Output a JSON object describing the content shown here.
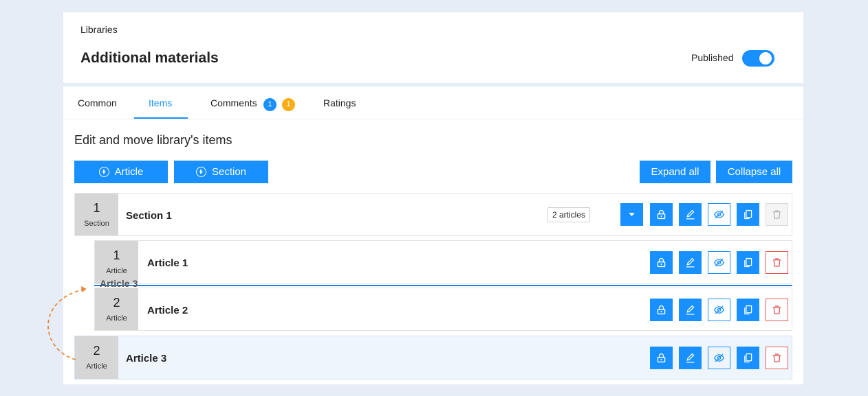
{
  "header": {
    "breadcrumb": "Libraries",
    "title": "Additional materials",
    "published_label": "Published",
    "published": true
  },
  "tabs": [
    {
      "label": "Common",
      "active": false
    },
    {
      "label": "Items",
      "active": true
    },
    {
      "label": "Comments",
      "active": false,
      "badges": [
        "1",
        "1"
      ]
    },
    {
      "label": "Ratings",
      "active": false
    }
  ],
  "content": {
    "heading": "Edit and move library's items",
    "add_article_label": "Article",
    "add_section_label": "Section",
    "expand_all_label": "Expand all",
    "collapse_all_label": "Collapse all"
  },
  "items": [
    {
      "number": "1",
      "kind": "Section",
      "title": "Section 1",
      "count_label": "2 articles"
    },
    {
      "number": "1",
      "kind": "Article",
      "title": "Article 1"
    },
    {
      "number": "2",
      "kind": "Article",
      "title": "Article 2"
    },
    {
      "number": "2",
      "kind": "Article",
      "title": "Article 3"
    }
  ],
  "drag": {
    "ghost_label": "Article 3"
  },
  "colors": {
    "accent": "#1890ff",
    "badge_orange": "#faad14",
    "danger": "#e85555",
    "drag_arrow": "#e8893a"
  }
}
